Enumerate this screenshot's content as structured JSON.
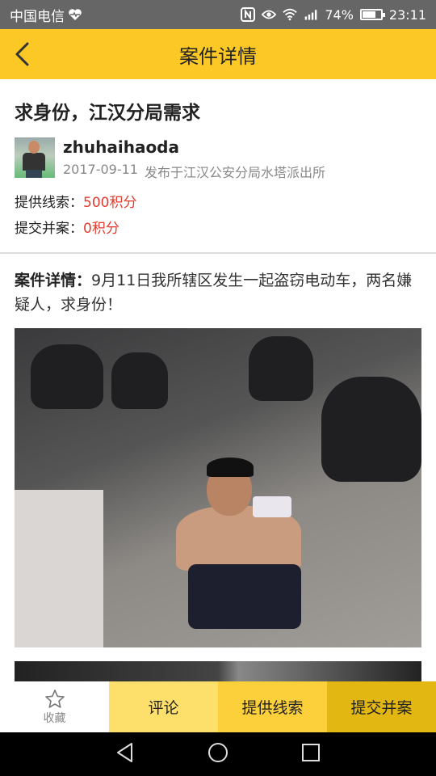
{
  "status_bar": {
    "carrier": "中国电信",
    "battery_pct": "74%",
    "time": "23:11",
    "battery_level": 0.74
  },
  "header": {
    "title": "案件详情"
  },
  "case": {
    "title": "求身份，江汉分局需求",
    "username": "zhuhaihaoda",
    "date": "2017-09-11",
    "publisher": "发布于江汉公安分局水塔派出所",
    "clue_label": "提供线索：",
    "clue_points": "500积分",
    "merge_label": "提交并案：",
    "merge_points": "0积分",
    "detail_label": "案件详情：",
    "detail_text": "9月11日我所辖区发生一起盗窃电动车，两名嫌疑人，求身份！"
  },
  "bottom_bar": {
    "favorite_label": "收藏",
    "comment_label": "评论",
    "clue_label": "提供线索",
    "submit_label": "提交并案"
  },
  "colors": {
    "accent": "#fcc826",
    "points_red": "#e23b2e"
  }
}
